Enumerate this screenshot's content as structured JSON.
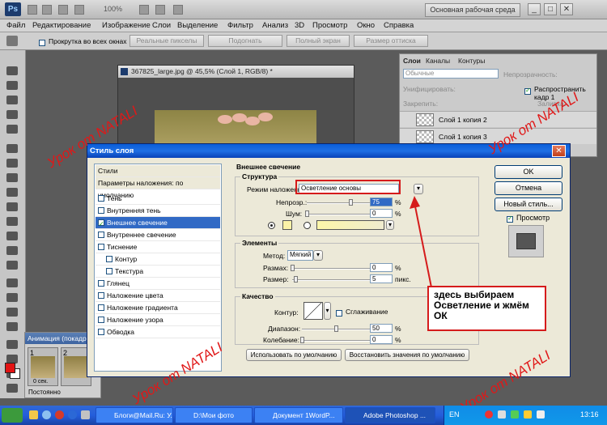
{
  "app": {
    "zoom": "100%",
    "workspace": "Основная рабочая среда"
  },
  "menu": [
    "Файл",
    "Редактирование",
    "Изображение",
    "Слои",
    "Выделение",
    "Фильтр",
    "Анализ",
    "3D",
    "Просмотр",
    "Окно",
    "Справка"
  ],
  "options": {
    "scroll_all": "Прокрутка во всех окнах",
    "btn1": "Реальные пикселы",
    "btn2": "Подогнать",
    "btn3": "Полный экран",
    "btn4": "Размер оттиска"
  },
  "document": {
    "title": "367825_large.jpg @ 45,5% (Слой 1, RGB/8) *"
  },
  "animation": {
    "title": "Анимация (покадр",
    "frame1": "1",
    "frame2": "2",
    "delay": "0 сек.",
    "loop": "Постоянно"
  },
  "layers": {
    "tabs": [
      "Слои",
      "Каналы",
      "Контуры"
    ],
    "blend": "Обычные",
    "opacity_label": "Непрозрачность:",
    "unify_label": "Унифицировать:",
    "propagate": "Распространить кадр 1",
    "lock_label": "Закрепить:",
    "fill_label": "Заливка:",
    "items": [
      "Слой 1 копия 2",
      "Слой 1 копия 3"
    ]
  },
  "dialog": {
    "title": "Стиль слоя",
    "list": [
      {
        "label": "Стили",
        "type": "head"
      },
      {
        "label": "Параметры наложения: по умолчанию",
        "type": "head"
      },
      {
        "label": "Тень",
        "type": "cb",
        "checked": false
      },
      {
        "label": "Внутренняя тень",
        "type": "cb",
        "checked": false
      },
      {
        "label": "Внешнее свечение",
        "type": "sel",
        "checked": true
      },
      {
        "label": "Внутреннее свечение",
        "type": "cb",
        "checked": false
      },
      {
        "label": "Тиснение",
        "type": "cb",
        "checked": false
      },
      {
        "label": "Контур",
        "type": "sub",
        "checked": false
      },
      {
        "label": "Текстура",
        "type": "sub",
        "checked": false
      },
      {
        "label": "Глянец",
        "type": "cb",
        "checked": false
      },
      {
        "label": "Наложение цвета",
        "type": "cb",
        "checked": false
      },
      {
        "label": "Наложение градиента",
        "type": "cb",
        "checked": false
      },
      {
        "label": "Наложение узора",
        "type": "cb",
        "checked": false
      },
      {
        "label": "Обводка",
        "type": "cb",
        "checked": false
      }
    ],
    "section": "Внешнее свечение",
    "structure": {
      "legend": "Структура",
      "mode_label": "Режим наложения:",
      "mode_value": "Осветление основы",
      "opacity_label": "Непрозр.:",
      "opacity_value": "75",
      "noise_label": "Шум:",
      "noise_value": "0",
      "pct": "%"
    },
    "elements": {
      "legend": "Элементы",
      "method_label": "Метод:",
      "method_value": "Мягкий",
      "spread_label": "Размах:",
      "spread_value": "0",
      "size_label": "Размер:",
      "size_value": "5",
      "size_unit": "пикс."
    },
    "quality": {
      "legend": "Качество",
      "contour_label": "Контур:",
      "antialias": "Сглаживание",
      "range_label": "Диапазон:",
      "range_value": "50",
      "jitter_label": "Колебание:",
      "jitter_value": "0"
    },
    "btn_default": "Использовать по умолчанию",
    "btn_reset": "Восстановить значения по умолчанию",
    "ok": "OK",
    "cancel": "Отмена",
    "new_style": "Новый стиль...",
    "preview": "Просмотр"
  },
  "annotation": {
    "callout": "здесь выбираем Осветление и жмём ОК",
    "watermark": "Урок от NATALI"
  },
  "taskbar": {
    "items": [
      "Блоги@Mail.Ru: У...",
      "D:\\Мои фото",
      "Документ 1WordP...",
      "Adobe Photoshop ..."
    ],
    "lang": "EN",
    "time": "13:16"
  },
  "colors": {
    "accent_red": "#d51b1b",
    "xp_blue": "#245edb",
    "fg_color": "#e21313"
  }
}
